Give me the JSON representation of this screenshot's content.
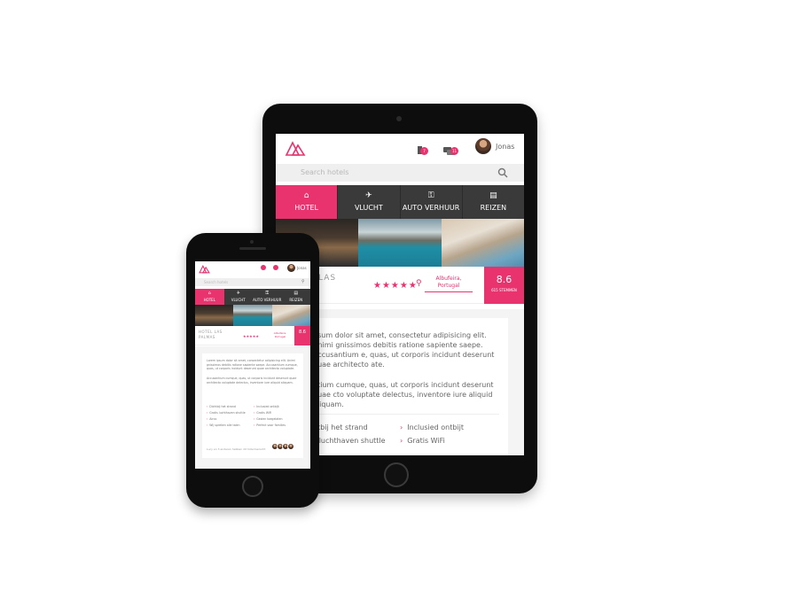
{
  "app": {
    "user_name": "Jonas",
    "badge_counts": [
      "7",
      "11"
    ],
    "search_placeholder": "Search hotels",
    "accent_color": "#e8336f"
  },
  "nav": {
    "tabs": [
      {
        "label": "HOTEL",
        "icon": "home-icon",
        "active": true
      },
      {
        "label": "VLUCHT",
        "icon": "plane-icon",
        "active": false
      },
      {
        "label": "AUTO VERHUUR",
        "icon": "key-icon",
        "active": false
      },
      {
        "label": "REIZEN",
        "icon": "map-icon",
        "active": false
      }
    ]
  },
  "hotel": {
    "name_fragment": "LAS",
    "phone_name": "HOTEL LAS PALMAS",
    "stars": "★★★★★",
    "location": "Albufeira, Portugal",
    "score": "8.6",
    "score_label": "615 STEMMEN"
  },
  "tablet_content": {
    "para1": "psum dolor sit amet, consectetur adipisicing elit. Animi gnissimos debitis ratione sapiente saepe. Accusantium e, quas, ut corporis incidunt deserunt quae architecto ate.",
    "para2": "ntium cumque, quas, ut corporis incidunt deserunt quae cto voluptate delectus, inventore iure aliquid aliquam.",
    "features": [
      "ntbij het strand",
      "Inclusied ontbijt",
      "s luchthaven shuttle",
      "Gratis WiFi"
    ]
  },
  "phone_content": {
    "para1": "Lorem ipsum dolor sit amet, consectetur adipisicing elit. Animi gnissimos debitis ratione sapiente saepe. Accusantium cumque, quas, ut corporis incidunt deserunt quae architecto voluptate.",
    "para2": "Accusantium cumque, quas, ut corporis incidunt deserunt quae architecto voluptate delectus, inventore iure aliquid aliquam.",
    "features": [
      "Dichtbij het strand",
      "Inclusied ontbijt",
      "Gratis luchthaven shuttle",
      "Gratis WiFi",
      "Airco",
      "Gezien toegelaten",
      "Wij spreken alle talen",
      "Perfect voor families"
    ],
    "footer": "Lucy en 3 anderen hebben dit hotel bezocht"
  }
}
